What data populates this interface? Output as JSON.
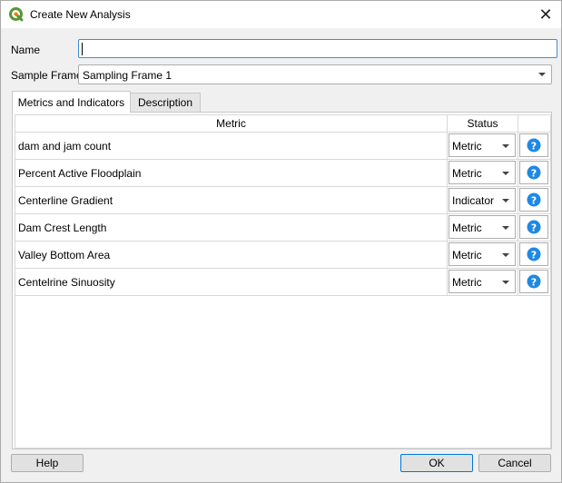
{
  "window": {
    "title": "Create New Analysis",
    "close_glyph": "✕"
  },
  "form": {
    "name_label": "Name",
    "name_value": "",
    "sample_frame_label": "Sample Frame",
    "sample_frame_value": "Sampling Frame 1"
  },
  "tabs": [
    {
      "label": "Metrics and Indicators",
      "active": true
    },
    {
      "label": "Description",
      "active": false
    }
  ],
  "table": {
    "headers": {
      "metric": "Metric",
      "status": "Status",
      "help": ""
    },
    "rows": [
      {
        "metric": "dam and jam count",
        "status": "Metric"
      },
      {
        "metric": "Percent Active Floodplain",
        "status": "Metric"
      },
      {
        "metric": "Centerline Gradient",
        "status": "Indicator"
      },
      {
        "metric": "Dam Crest Length",
        "status": "Metric"
      },
      {
        "metric": "Valley Bottom Area",
        "status": "Metric"
      },
      {
        "metric": "Centelrine Sinuosity",
        "status": "Metric"
      }
    ]
  },
  "buttons": {
    "help": "Help",
    "ok": "OK",
    "cancel": "Cancel"
  },
  "colors": {
    "accent": "#0078d7",
    "help_icon": "#1e88e5",
    "qgis_green": "#589632"
  }
}
